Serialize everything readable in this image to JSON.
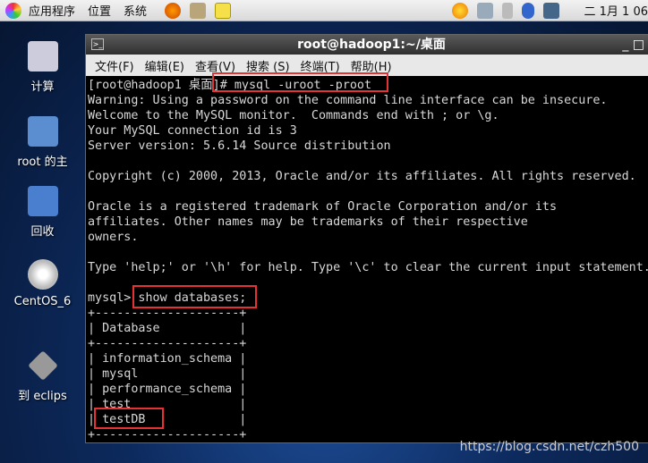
{
  "panel": {
    "menus": [
      "应用程序",
      "位置",
      "系统"
    ],
    "clock": "二 1月 1 06"
  },
  "desktop": {
    "icons": [
      "计算",
      "root 的主",
      "回收",
      "CentOS_6",
      "到 eclips"
    ]
  },
  "terminal": {
    "title": "root@hadoop1:~/桌面",
    "menu": [
      "文件(F)",
      "编辑(E)",
      "查看(V)",
      "搜索 (S)",
      "终端(T)",
      "帮助(H)"
    ],
    "lines": [
      "[root@hadoop1 桌面]# mysql -uroot -proot",
      "Warning: Using a password on the command line interface can be insecure.",
      "Welcome to the MySQL monitor.  Commands end with ; or \\g.",
      "Your MySQL connection id is 3",
      "Server version: 5.6.14 Source distribution",
      "",
      "Copyright (c) 2000, 2013, Oracle and/or its affiliates. All rights reserved.",
      "",
      "Oracle is a registered trademark of Oracle Corporation and/or its",
      "affiliates. Other names may be trademarks of their respective",
      "owners.",
      "",
      "Type 'help;' or '\\h' for help. Type '\\c' to clear the current input statement.",
      "",
      "mysql> show databases;",
      "+--------------------+",
      "| Database           |",
      "+--------------------+",
      "| information_schema |",
      "| mysql              |",
      "| performance_schema |",
      "| test               |",
      "| testDB             |",
      "+--------------------+"
    ]
  },
  "watermark": "https://blog.csdn.net/czh500"
}
